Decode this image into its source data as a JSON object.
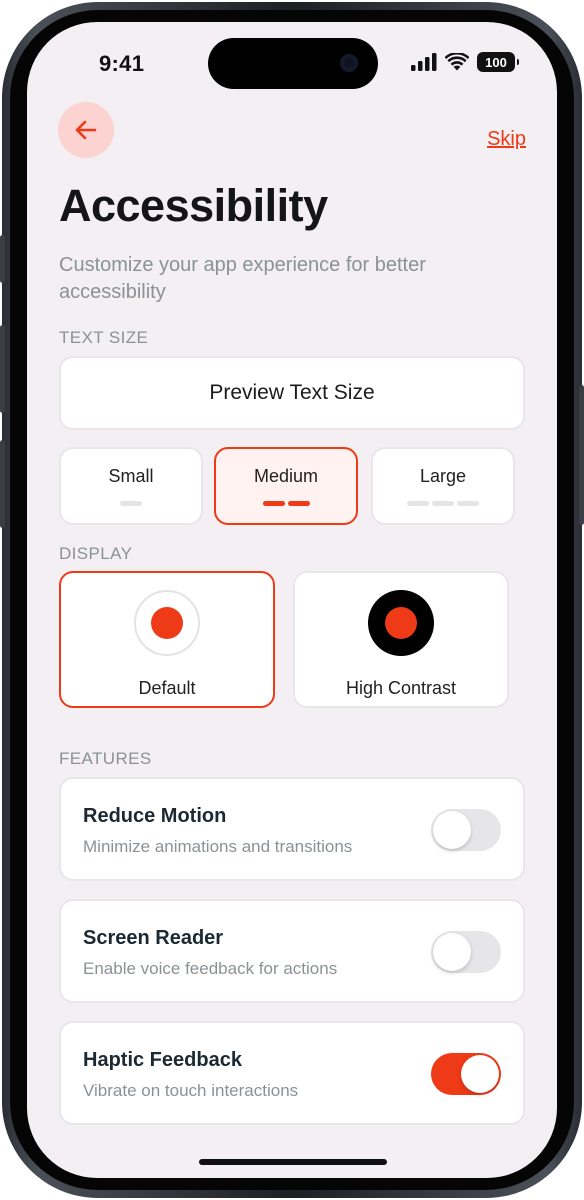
{
  "status_bar": {
    "time": "9:41",
    "battery": "100"
  },
  "header": {
    "back_icon": "arrow-left-icon",
    "skip_label": "Skip"
  },
  "title": "Accessibility",
  "subtitle": "Customize your app experience for better accessibility",
  "text_size": {
    "section_label": "TEXT SIZE",
    "preview_text": "Preview Text Size",
    "options": [
      {
        "label": "Small",
        "selected": false
      },
      {
        "label": "Medium",
        "selected": true
      },
      {
        "label": "Large",
        "selected": false
      }
    ]
  },
  "display": {
    "section_label": "DISPLAY",
    "options": [
      {
        "label": "Default",
        "selected": true
      },
      {
        "label": "High Contrast",
        "selected": false
      }
    ]
  },
  "features": {
    "section_label": "FEATURES",
    "items": [
      {
        "title": "Reduce Motion",
        "description": "Minimize animations and transitions",
        "enabled": false
      },
      {
        "title": "Screen Reader",
        "description": "Enable voice feedback for actions",
        "enabled": false
      },
      {
        "title": "Haptic Feedback",
        "description": "Vibrate on touch interactions",
        "enabled": true
      }
    ]
  },
  "colors": {
    "accent": "#ee3a17",
    "accent_light": "#fcd3d0",
    "background": "#f3eff2",
    "muted_text": "#8b9296"
  }
}
